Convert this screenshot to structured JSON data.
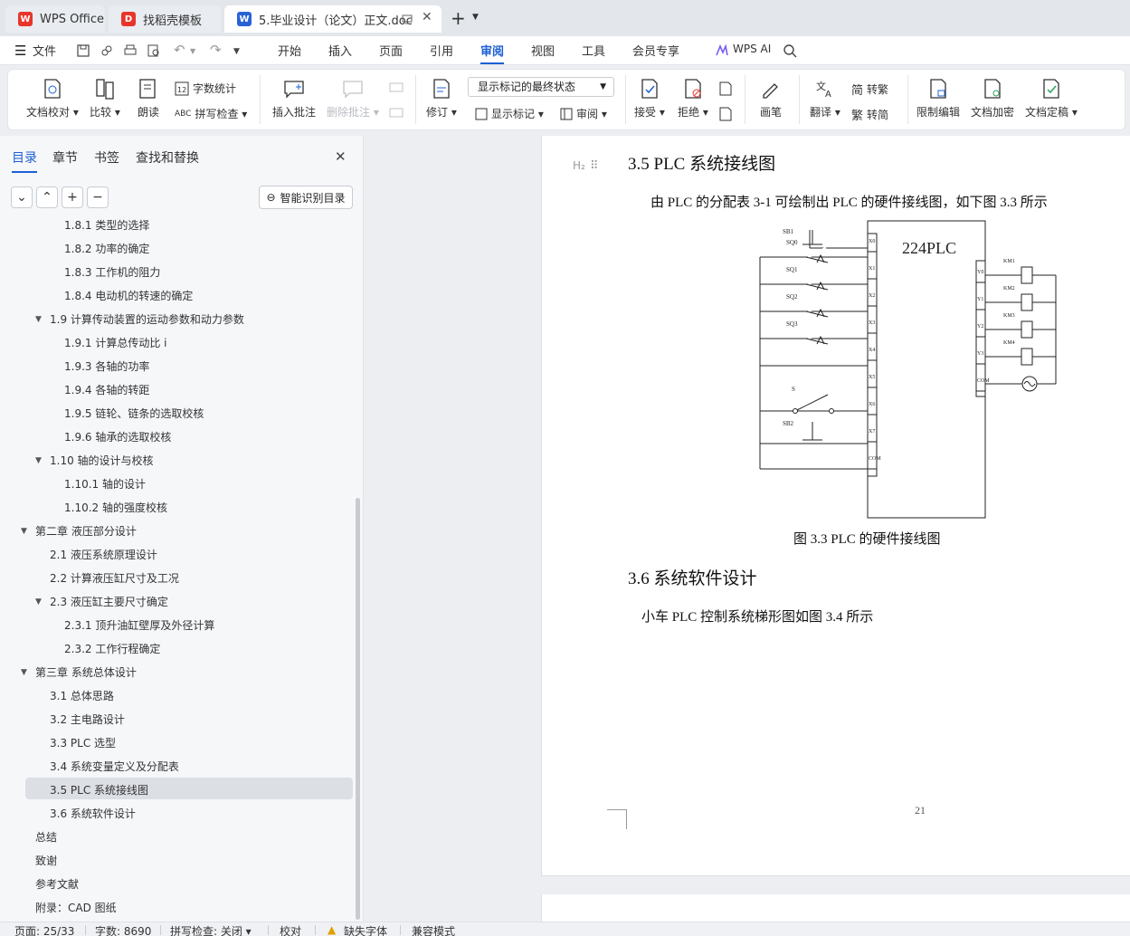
{
  "tabs": [
    {
      "label": "WPS Office",
      "icon": "wps-logo-icon"
    },
    {
      "label": "找稻壳模板",
      "icon": "docer-icon"
    },
    {
      "label": "5.毕业设计（论文）正文.doc",
      "icon": "word-doc-icon"
    }
  ],
  "menu": {
    "file": "文件",
    "items": [
      "开始",
      "插入",
      "页面",
      "引用",
      "审阅",
      "视图",
      "工具",
      "会员专享"
    ],
    "active": "审阅",
    "ai": "WPS AI"
  },
  "ribbon": {
    "doc_proof": "文档校对",
    "compare": "比较",
    "read_aloud": "朗读",
    "word_count": "字数统计",
    "spell_check": "拼写检查",
    "insert_comment": "插入批注",
    "delete_comment": "删除批注",
    "revise": "修订",
    "markup_state": "显示标记的最终状态",
    "show_markup": "显示标记",
    "review": "审阅",
    "accept": "接受",
    "reject": "拒绝",
    "pen": "画笔",
    "translate": "翻译",
    "to_traditional": "转繁",
    "to_simplified": "转简",
    "trad_glyph": "繁",
    "simp_glyph": "简",
    "restrict_edit": "限制编辑",
    "encrypt": "文档加密",
    "finalize": "文档定稿"
  },
  "nav": {
    "tabs": [
      "目录",
      "章节",
      "书签",
      "查找和替换"
    ],
    "active": "目录",
    "smart_btn": "智能识别目录",
    "toc": [
      {
        "text": "1.8.1 类型的选择",
        "level": 3
      },
      {
        "text": "1.8.2 功率的确定",
        "level": 3
      },
      {
        "text": "1.8.3 工作机的阻力",
        "level": 3
      },
      {
        "text": "1.8.4 电动机的转速的确定",
        "level": 3
      },
      {
        "text": "1.9 计算传动装置的运动参数和动力参数",
        "level": 2,
        "expanded": true
      },
      {
        "text": "1.9.1  计算总传动比 i",
        "level": 3
      },
      {
        "text": "1.9.3  各轴的功率",
        "level": 3
      },
      {
        "text": "1.9.4 各轴的转距",
        "level": 3
      },
      {
        "text": "1.9.5 链轮、链条的选取校核",
        "level": 3
      },
      {
        "text": "1.9.6  轴承的选取校核",
        "level": 3
      },
      {
        "text": "1.10 轴的设计与校核",
        "level": 2,
        "expanded": true
      },
      {
        "text": "1.10.1 轴的设计",
        "level": 3
      },
      {
        "text": "1.10.2  轴的强度校核",
        "level": 3
      },
      {
        "text": "第二章  液压部分设计",
        "level": 1,
        "expanded": true
      },
      {
        "text": "2.1 液压系统原理设计",
        "level": 2
      },
      {
        "text": "2.2 计算液压缸尺寸及工况",
        "level": 2
      },
      {
        "text": "2.3 液压缸主要尺寸确定",
        "level": 2,
        "expanded": true
      },
      {
        "text": "2.3.1 顶升油缸壁厚及外径计算",
        "level": 3
      },
      {
        "text": "2.3.2 工作行程确定",
        "level": 3
      },
      {
        "text": "第三章  系统总体设计",
        "level": 1,
        "expanded": true
      },
      {
        "text": "3.1 总体思路",
        "level": 2
      },
      {
        "text": "3.2 主电路设计",
        "level": 2
      },
      {
        "text": "3.3 PLC 选型",
        "level": 2
      },
      {
        "text": "3.4 系统变量定义及分配表",
        "level": 2
      },
      {
        "text": "3.5 PLC 系统接线图",
        "level": 2,
        "selected": true
      },
      {
        "text": "3.6 系统软件设计",
        "level": 2
      },
      {
        "text": "总结",
        "level": 1
      },
      {
        "text": "致谢",
        "level": 1
      },
      {
        "text": "参考文献",
        "level": 1
      },
      {
        "text": "附录：CAD 图纸",
        "level": 1
      }
    ]
  },
  "document": {
    "heading_marker": "H₂",
    "heading1": "3.5  PLC 系统接线图",
    "para1": "由 PLC 的分配表 3-1 可绘制出 PLC 的硬件接线图，如下图 3.3 所示",
    "figure": {
      "plc_label": "224PLC",
      "inputs": [
        "SB1",
        "SQ0",
        "SQ1",
        "SQ2",
        "SQ3",
        "S",
        "SB2"
      ],
      "input_terms": [
        "X0",
        "X1",
        "X2",
        "X3",
        "X4",
        "X5",
        "X6",
        "X7",
        "COM"
      ],
      "output_terms": [
        "Y0",
        "Y1",
        "Y2",
        "Y3",
        "COM"
      ],
      "outputs": [
        "KM1",
        "KM2",
        "KM3",
        "KM4"
      ]
    },
    "caption": "图 3.3 PLC 的硬件接线图",
    "heading2": "3.6 系统软件设计",
    "para2": "小车 PLC 控制系统梯形图如图 3.4 所示",
    "page_number": "21"
  },
  "status": {
    "page": "页面: 25/33",
    "words": "字数: 8690",
    "spell": "拼写检查: 关闭",
    "proof": "校对",
    "missing_font": "缺失字体",
    "compat": "兼容模式"
  },
  "colors": {
    "accent": "#1c5fd4",
    "wps_red": "#e8352b",
    "doc_blue": "#2a62d6"
  }
}
